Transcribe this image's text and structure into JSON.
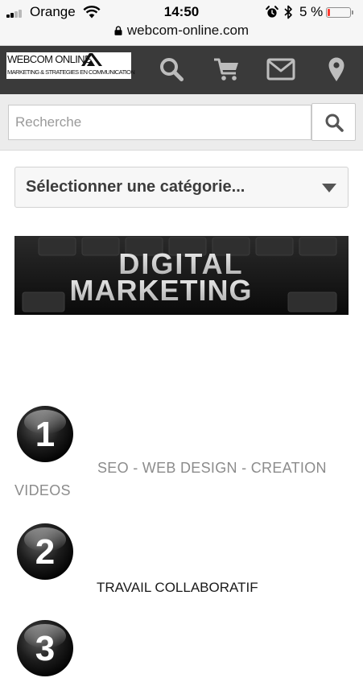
{
  "status_bar": {
    "carrier": "Orange",
    "time": "14:50",
    "battery": "5 %",
    "battery_level": 0.05,
    "url": "webcom-online.com",
    "icons": [
      "signal-icon",
      "wifi-icon",
      "alarm-icon",
      "bluetooth-icon",
      "battery-icon",
      "lock-icon"
    ]
  },
  "header": {
    "logo_name": "WEBCOM ONLINE",
    "logo_tagline": "MARKETING & STRATEGIES EN COMMUNICATION",
    "icons": [
      "search-icon",
      "cart-icon",
      "mail-icon",
      "location-pin-icon"
    ]
  },
  "search": {
    "placeholder": "Recherche",
    "value": ""
  },
  "category_select": {
    "selected": "Sélectionner une catégorie..."
  },
  "banner": {
    "line1": "DIGITAL",
    "line2": "MARKETING"
  },
  "items": [
    {
      "number": "1",
      "label_line1": "SEO - WEB DESIGN - CREATION",
      "label_line2": "VIDEOS"
    },
    {
      "number": "2",
      "label": "TRAVAIL COLLABORATIF"
    },
    {
      "number": "3"
    }
  ],
  "colors": {
    "header_bg": "#3a3a3a",
    "header_icon": "#bdbdbd",
    "search_band": "#ececec",
    "item1_text": "#8c8c8c",
    "item2_text": "#1a1a1a",
    "battery_low": "#ff3b30"
  }
}
